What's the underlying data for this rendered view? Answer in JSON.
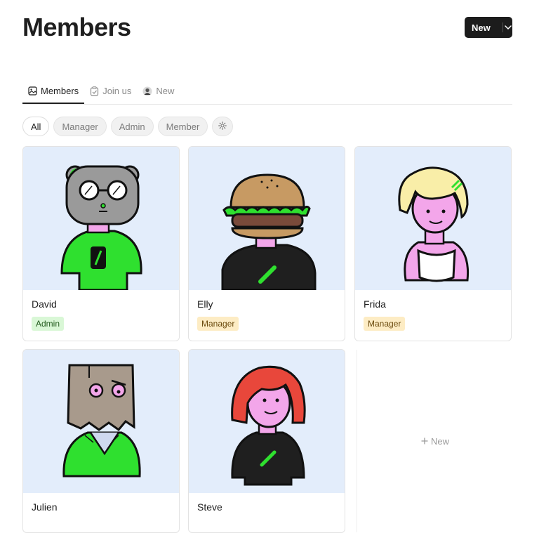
{
  "header": {
    "title": "Members",
    "new_button_label": "New"
  },
  "tabs": [
    {
      "label": "Members",
      "icon": "image-icon",
      "active": true
    },
    {
      "label": "Join us",
      "icon": "checklist-icon",
      "active": false
    },
    {
      "label": "New",
      "icon": "avatar-icon",
      "active": false
    }
  ],
  "filters": {
    "chips": [
      "All",
      "Manager",
      "Admin",
      "Member"
    ],
    "selected": "All",
    "settings_icon": "gear-icon"
  },
  "members": [
    {
      "name": "David",
      "role": "Admin"
    },
    {
      "name": "Elly",
      "role": "Manager"
    },
    {
      "name": "Frida",
      "role": "Manager"
    },
    {
      "name": "Julien",
      "role": ""
    },
    {
      "name": "Steve",
      "role": ""
    }
  ],
  "add_card": {
    "label": "New",
    "icon": "plus-icon"
  },
  "colors": {
    "card_art_bg": "#e3edfb",
    "accent_green": "#2fe02f",
    "admin_badge": "#d9f7d6",
    "manager_badge": "#fdecc4",
    "button_bg": "#1c1c1c"
  }
}
